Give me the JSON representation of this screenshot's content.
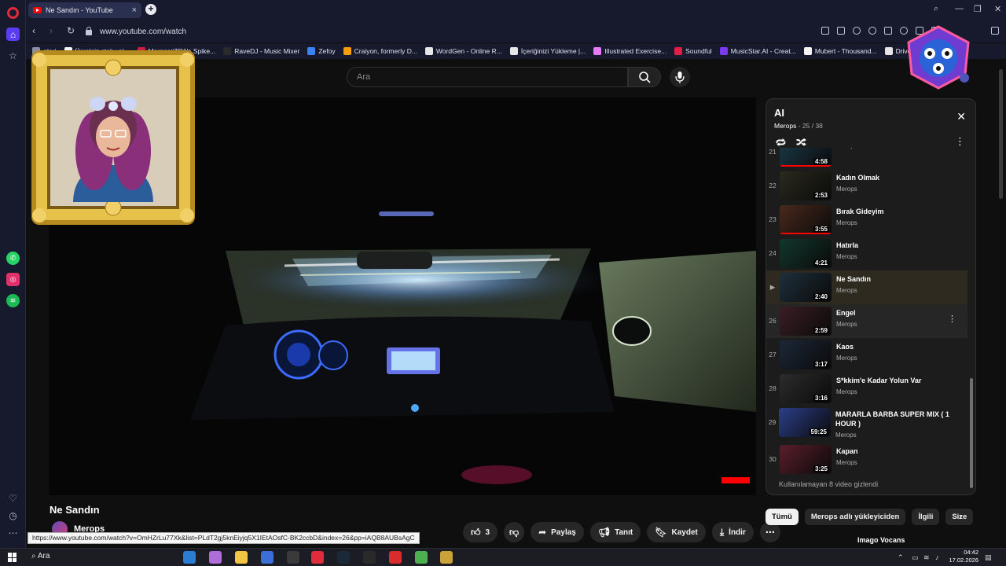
{
  "browser": {
    "tab_title": "Ne Sandın - YouTube",
    "url": "www.youtube.com/watch",
    "bookmarks": [
      {
        "label": "atari",
        "color": "#8a8fa8"
      },
      {
        "label": "Ücretsiz stok vol...",
        "color": "#f5f5f5"
      },
      {
        "label": "Merops#TR1's Spike...",
        "color": "#d01f3c"
      },
      {
        "label": "RaveDJ - Music Mixer",
        "color": "#2a2a2a"
      },
      {
        "label": "Zefoy",
        "color": "#3b82f6"
      },
      {
        "label": "Craiyon, formerly D...",
        "color": "#f59e0b"
      },
      {
        "label": "WordGen - Online R...",
        "color": "#e5e5e5"
      },
      {
        "label": "İçeriğinizi Yükleme |...",
        "color": "#e5e5e5"
      },
      {
        "label": "Illustrated Exercise...",
        "color": "#e879f9"
      },
      {
        "label": "Soundful",
        "color": "#e11d48"
      },
      {
        "label": "MusicStar.AI - Creat...",
        "color": "#7c3aed"
      },
      {
        "label": "Mubert - Thousand...",
        "color": "#f5f5f5"
      },
      {
        "label": "Drive and Listen -...",
        "color": "#e5e5e5"
      }
    ],
    "status_url": "https://www.youtube.com/watch?v=OmHZrLu77Xk&list=PLdT2gj5knEiyjq5X1IEtAOsfC-BK2ccbD&index=26&pp=iAQB8AUBsAgC"
  },
  "search": {
    "placeholder": "Ara"
  },
  "video": {
    "title": "Ne Sandın",
    "channel": "Merops",
    "likes": "3",
    "share_label": "Paylaş",
    "promote_label": "Tanıt",
    "save_label": "Kaydet",
    "download_label": "İndir"
  },
  "playlist": {
    "title": "AI",
    "owner": "Merops",
    "position": "- 25 / 38",
    "hidden_note": "Kullanılamayan 8 video gizlendi",
    "items": [
      {
        "index": "21",
        "title": "",
        "channel": "Merops",
        "duration": "4:58",
        "progress": 1.0,
        "thumb": "#1b3b4a"
      },
      {
        "index": "22",
        "title": "Kadın Olmak",
        "channel": "Merops",
        "duration": "2:53",
        "progress": 0,
        "thumb": "#2a2a1e"
      },
      {
        "index": "23",
        "title": "Bırak Gideyim",
        "channel": "Merops",
        "duration": "3:55",
        "progress": 1.0,
        "thumb": "#4a2a1c"
      },
      {
        "index": "24",
        "title": "Hatırla",
        "channel": "Merops",
        "duration": "4:21",
        "progress": 0,
        "thumb": "#12372c"
      },
      {
        "index": "▶",
        "title": "Ne Sandın",
        "channel": "Merops",
        "duration": "2:40",
        "progress": 0,
        "thumb": "#1e2f3c"
      },
      {
        "index": "26",
        "title": "Engel",
        "channel": "Merops",
        "duration": "2:59",
        "progress": 0,
        "thumb": "#3a1e24"
      },
      {
        "index": "27",
        "title": "Kaos",
        "channel": "Merops",
        "duration": "3:17",
        "progress": 0,
        "thumb": "#1c2738"
      },
      {
        "index": "28",
        "title": "S*kkim'e Kadar Yolun Var",
        "channel": "Merops",
        "duration": "3:16",
        "progress": 0,
        "thumb": "#2c2c2c"
      },
      {
        "index": "29",
        "title": "MARARLA BARBA SUPER MIX ( 1 HOUR )",
        "channel": "Merops",
        "duration": "59:25",
        "progress": 0,
        "thumb": "#2b3f8a"
      },
      {
        "index": "30",
        "title": "Kapan",
        "channel": "Merops",
        "duration": "3:25",
        "progress": 0,
        "thumb": "#5a1e2a"
      }
    ]
  },
  "chips": [
    "Tümü",
    "Merops adlı yükleyiciden",
    "İlgili",
    "Size"
  ],
  "next_video": {
    "title": "Imago Vocans"
  },
  "taskbar": {
    "search_label": "Ara",
    "time": "04:42",
    "date": "17.02.2026",
    "apps": [
      {
        "name": "edge-icon",
        "color": "#2b7cd3"
      },
      {
        "name": "copilot-icon",
        "color": "#b06cd8"
      },
      {
        "name": "explorer-icon",
        "color": "#f4c542"
      },
      {
        "name": "app-icon",
        "color": "#3c6ed8"
      },
      {
        "name": "speed-icon",
        "color": "#3a3a3a"
      },
      {
        "name": "opera-icon",
        "color": "#e02b3c"
      },
      {
        "name": "steam-icon",
        "color": "#1b2838"
      },
      {
        "name": "epic-icon",
        "color": "#2a2a2a"
      },
      {
        "name": "media-icon",
        "color": "#d92c2c"
      },
      {
        "name": "chrome-icon",
        "color": "#4caf50"
      },
      {
        "name": "app2-icon",
        "color": "#c9a33a"
      }
    ]
  }
}
